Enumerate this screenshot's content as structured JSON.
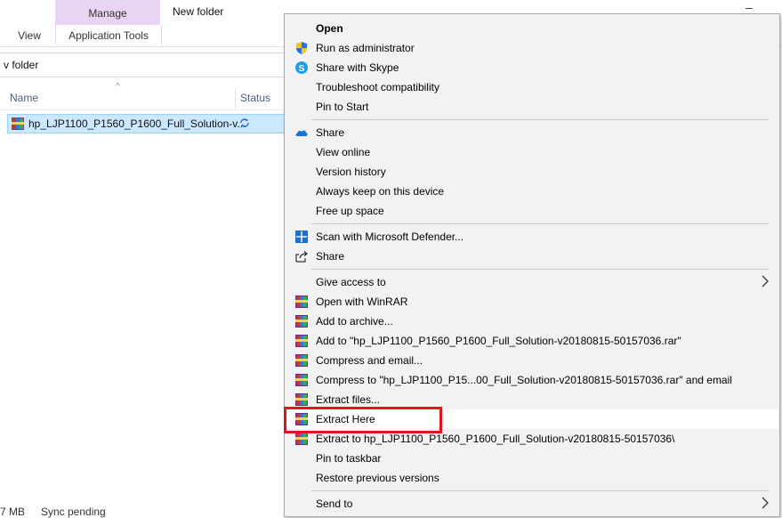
{
  "ribbon": {
    "manage_label": "Manage",
    "tools_label": "Application Tools",
    "view_label": "View",
    "window_title": "New folder",
    "minimize_glyph": "–"
  },
  "address": {
    "path_text": "v folder"
  },
  "columns": {
    "name": "Name",
    "status": "Status",
    "sort_glyph": "^"
  },
  "file": {
    "name": "hp_LJP1100_P1560_P1600_Full_Solution-v...",
    "icon": "winrar-archive-icon",
    "status_icon": "sync-pending-icon"
  },
  "statusbar": {
    "size": "7 MB",
    "sync": "Sync pending"
  },
  "menu": {
    "items": [
      {
        "label": "Open",
        "icon": "",
        "bold": true
      },
      {
        "label": "Run as administrator",
        "icon": "uac-shield-icon"
      },
      {
        "label": "Share with Skype",
        "icon": "skype-icon"
      },
      {
        "label": "Troubleshoot compatibility",
        "icon": ""
      },
      {
        "label": "Pin to Start",
        "icon": ""
      },
      {
        "label": "Share",
        "icon": "onedrive-cloud-icon"
      },
      {
        "label": "View online",
        "icon": ""
      },
      {
        "label": "Version history",
        "icon": ""
      },
      {
        "label": "Always keep on this device",
        "icon": ""
      },
      {
        "label": "Free up space",
        "icon": ""
      },
      {
        "label": "Scan with Microsoft Defender...",
        "icon": "defender-icon"
      },
      {
        "label": "Share",
        "icon": "share-icon"
      },
      {
        "label": "Give access to",
        "icon": "",
        "submenu": true
      },
      {
        "label": "Open with WinRAR",
        "icon": "winrar-icon"
      },
      {
        "label": "Add to archive...",
        "icon": "winrar-icon"
      },
      {
        "label": "Add to \"hp_LJP1100_P1560_P1600_Full_Solution-v20180815-50157036.rar\"",
        "icon": "winrar-icon"
      },
      {
        "label": "Compress and email...",
        "icon": "winrar-icon"
      },
      {
        "label": "Compress to \"hp_LJP1100_P15...00_Full_Solution-v20180815-50157036.rar\" and email",
        "icon": "winrar-icon"
      },
      {
        "label": "Extract files...",
        "icon": "winrar-icon"
      },
      {
        "label": "Extract Here",
        "icon": "winrar-icon",
        "hovered": true
      },
      {
        "label": "Extract to hp_LJP1100_P1560_P1600_Full_Solution-v20180815-50157036\\",
        "icon": "winrar-icon"
      },
      {
        "label": "Pin to taskbar",
        "icon": ""
      },
      {
        "label": "Restore previous versions",
        "icon": ""
      },
      {
        "label": "Send to",
        "icon": "",
        "submenu": true
      }
    ]
  },
  "colors": {
    "menu_bg": "#f2f2f2",
    "hover_bg": "#ffffff",
    "selection_bg": "#cce8ff",
    "manage_tab_bg": "#e9d5f3",
    "highlight_box": "#e0161e"
  }
}
